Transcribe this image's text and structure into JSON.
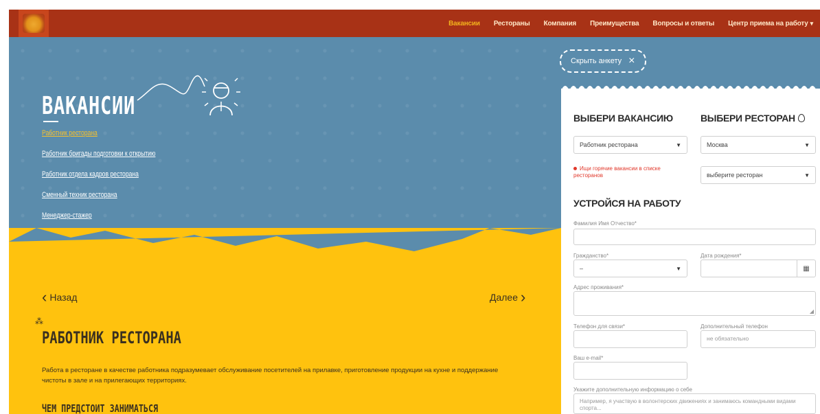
{
  "nav": {
    "items": [
      {
        "label": "Вакансии",
        "active": true
      },
      {
        "label": "Рестораны",
        "active": false
      },
      {
        "label": "Компания",
        "active": false
      },
      {
        "label": "Преимущества",
        "active": false
      },
      {
        "label": "Вопросы и ответы",
        "active": false
      },
      {
        "label": "Центр приема на работу",
        "active": false,
        "dropdown": true
      }
    ]
  },
  "hero": {
    "title": "ВАКАНСИИ",
    "categories": [
      {
        "label": "Работник ресторана",
        "active": true
      },
      {
        "label": "Работник бригады подготовки к открытию",
        "active": false
      },
      {
        "label": "Работник отдела кадров ресторана",
        "active": false
      },
      {
        "label": "Сменный техник ресторана",
        "active": false
      },
      {
        "label": "Менеджер-стажер",
        "active": false
      }
    ]
  },
  "vacancy": {
    "prev_label": "Назад",
    "next_label": "Далее",
    "title": "РАБОТНИК РЕСТОРАНА",
    "description": "Работа в ресторане в качестве работника подразумевает обслуживание посетителей на прилавке, приготовление продукции на кухне и поддержание чистоты в зале и на прилегающих территориях.",
    "subheading": "ЧЕМ ПРЕДСТОИТ ЗАНИМАТЬСЯ"
  },
  "form": {
    "hide_label": "Скрыть анкету",
    "choose_vacancy_heading": "ВЫБЕРИ ВАКАНСИЮ",
    "choose_restaurant_heading": "ВЫБЕРИ РЕСТОРАН",
    "vacancy_select": "Работник ресторана",
    "city_select": "Москва",
    "restaurant_select": "выберите ресторан",
    "hot_vacancies_hint": "Ищи горячие вакансии в списке ресторанов",
    "apply_heading": "УСТРОЙСЯ НА РАБОТУ",
    "fio_label": "Фамилия Имя Отчество*",
    "citizenship_label": "Гражданство*",
    "citizenship_value": "–",
    "birthdate_label": "Дата рождения*",
    "address_label": "Адрес проживания*",
    "phone_label": "Телефон для связи*",
    "extra_phone_label": "Дополнительный телефон",
    "extra_phone_placeholder": "не обязательно",
    "email_label": "Ваш e-mail*",
    "about_label": "Укажите дополнительную информацию о себе",
    "about_placeholder": "Например, я участвую в волонтерских движениях и занимаюсь командными видами спорта..."
  },
  "colors": {
    "topbar": "#a83216",
    "hero_blue": "#5b8cac",
    "hero_yellow": "#ffc20e",
    "accent": "#f3b21d",
    "hint_red": "#e1382b"
  }
}
